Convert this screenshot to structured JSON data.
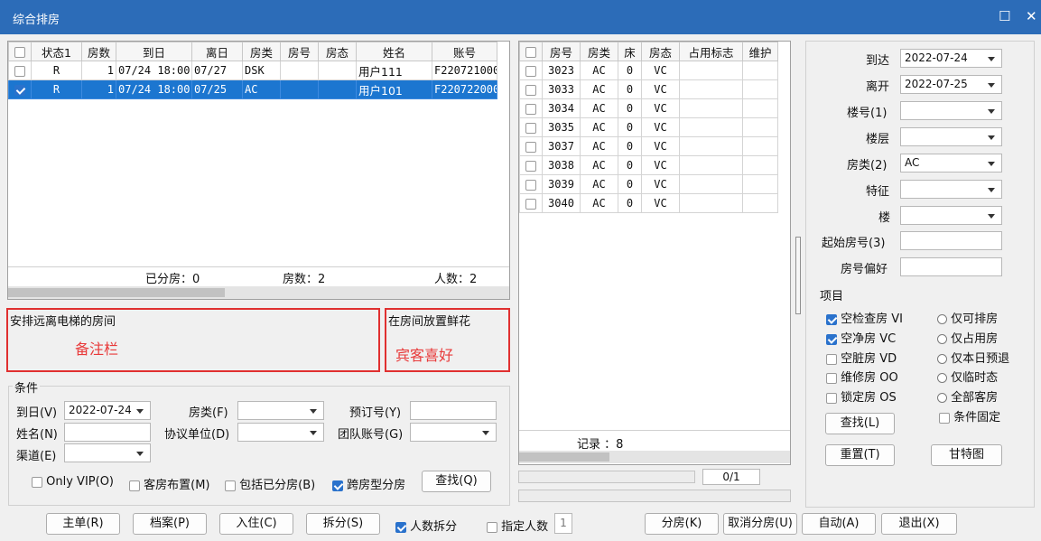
{
  "window": {
    "title": "综合排房",
    "maximize_icon": "☐",
    "close_icon": "✕"
  },
  "booking_table": {
    "headers": [
      "",
      "状态1",
      "房数",
      "到日",
      "离日",
      "房类",
      "房号",
      "房态",
      "姓名",
      "账号"
    ],
    "rows": [
      {
        "checked": false,
        "status": "R",
        "count": "1",
        "arrive": "07/24 18:00",
        "leave": "07/27",
        "type": "DSK",
        "room": "",
        "state": "",
        "name": "用户111",
        "account": "F220721000",
        "selected": false
      },
      {
        "checked": true,
        "status": "R",
        "count": "1",
        "arrive": "07/24 18:00",
        "leave": "07/25",
        "type": "AC",
        "room": "",
        "state": "",
        "name": "用户101",
        "account": "F220722000",
        "selected": true
      }
    ],
    "footer": {
      "assigned": "已分房：0",
      "rooms": "房数：2",
      "persons": "人数：2"
    }
  },
  "notes": {
    "remark_text": "安排远离电梯的房间",
    "remark_label": "备注栏",
    "pref_text": "在房间放置鲜花",
    "pref_label": "宾客喜好"
  },
  "conditions": {
    "title": "条件",
    "arrive_label": "到日(V)",
    "arrive_value": "2022-07-24",
    "roomtype_label": "房类(F)",
    "roomtype_value": "",
    "booking_label": "预订号(Y)",
    "booking_value": "",
    "name_label": "姓名(N)",
    "name_value": "",
    "agreement_label": "协议单位(D)",
    "agreement_value": "",
    "group_label": "团队账号(G)",
    "group_value": "",
    "channel_label": "渠道(E)",
    "channel_value": "",
    "only_vip": "Only VIP(O)",
    "room_layout": "客房布置(M)",
    "include_assigned": "包括已分房(B)",
    "cross_type": "跨房型分房",
    "search_btn": "查找(Q)"
  },
  "room_table": {
    "headers": [
      "",
      "房号",
      "房类",
      "床",
      "房态",
      "占用标志",
      "维护"
    ],
    "rows": [
      {
        "room": "3023",
        "type": "AC",
        "bed": "0",
        "state": "VC"
      },
      {
        "room": "3033",
        "type": "AC",
        "bed": "0",
        "state": "VC"
      },
      {
        "room": "3034",
        "type": "AC",
        "bed": "0",
        "state": "VC"
      },
      {
        "room": "3035",
        "type": "AC",
        "bed": "0",
        "state": "VC"
      },
      {
        "room": "3037",
        "type": "AC",
        "bed": "0",
        "state": "VC"
      },
      {
        "room": "3038",
        "type": "AC",
        "bed": "0",
        "state": "VC"
      },
      {
        "room": "3039",
        "type": "AC",
        "bed": "0",
        "state": "VC"
      },
      {
        "room": "3040",
        "type": "AC",
        "bed": "0",
        "state": "VC"
      }
    ],
    "records": "记录 ：8",
    "pager": "0/1"
  },
  "filters": {
    "arrive_label": "到达",
    "arrive_value": "2022-07-24",
    "leave_label": "离开",
    "leave_value": "2022-07-25",
    "building_label": "楼号(1)",
    "building_value": "",
    "floor_label": "楼层",
    "floor_value": "",
    "roomtype_label": "房类(2)",
    "roomtype_value": "AC",
    "feature_label": "特征",
    "feature_value": "",
    "tower_label": "楼",
    "tower_value": "",
    "start_room_label": "起始房号(3)",
    "start_room_value": "",
    "room_pref_label": "房号偏好",
    "room_pref_value": "",
    "items_title": "项目",
    "checks": [
      {
        "label": "空检查房 VI",
        "on": true
      },
      {
        "label": "空净房 VC",
        "on": true
      },
      {
        "label": "空脏房 VD",
        "on": false
      },
      {
        "label": "维修房 OO",
        "on": false
      },
      {
        "label": "锁定房 OS",
        "on": false
      }
    ],
    "radios": [
      "仅可排房",
      "仅占用房",
      "仅本日预退",
      "仅临时态",
      "全部客房"
    ],
    "fixed_cond": "条件固定",
    "search_btn": "查找(L)",
    "reset_btn": "重置(T)",
    "gantt_btn": "甘特图"
  },
  "bottom": {
    "master": "主单(R)",
    "profile": "档案(P)",
    "checkin": "入住(C)",
    "split": "拆分(S)",
    "person_split": "人数拆分",
    "person_split_on": true,
    "specify_persons": "指定人数",
    "persons_value": "1",
    "assign": "分房(K)",
    "cancel_assign": "取消分房(U)",
    "auto": "自动(A)",
    "exit": "退出(X)"
  }
}
